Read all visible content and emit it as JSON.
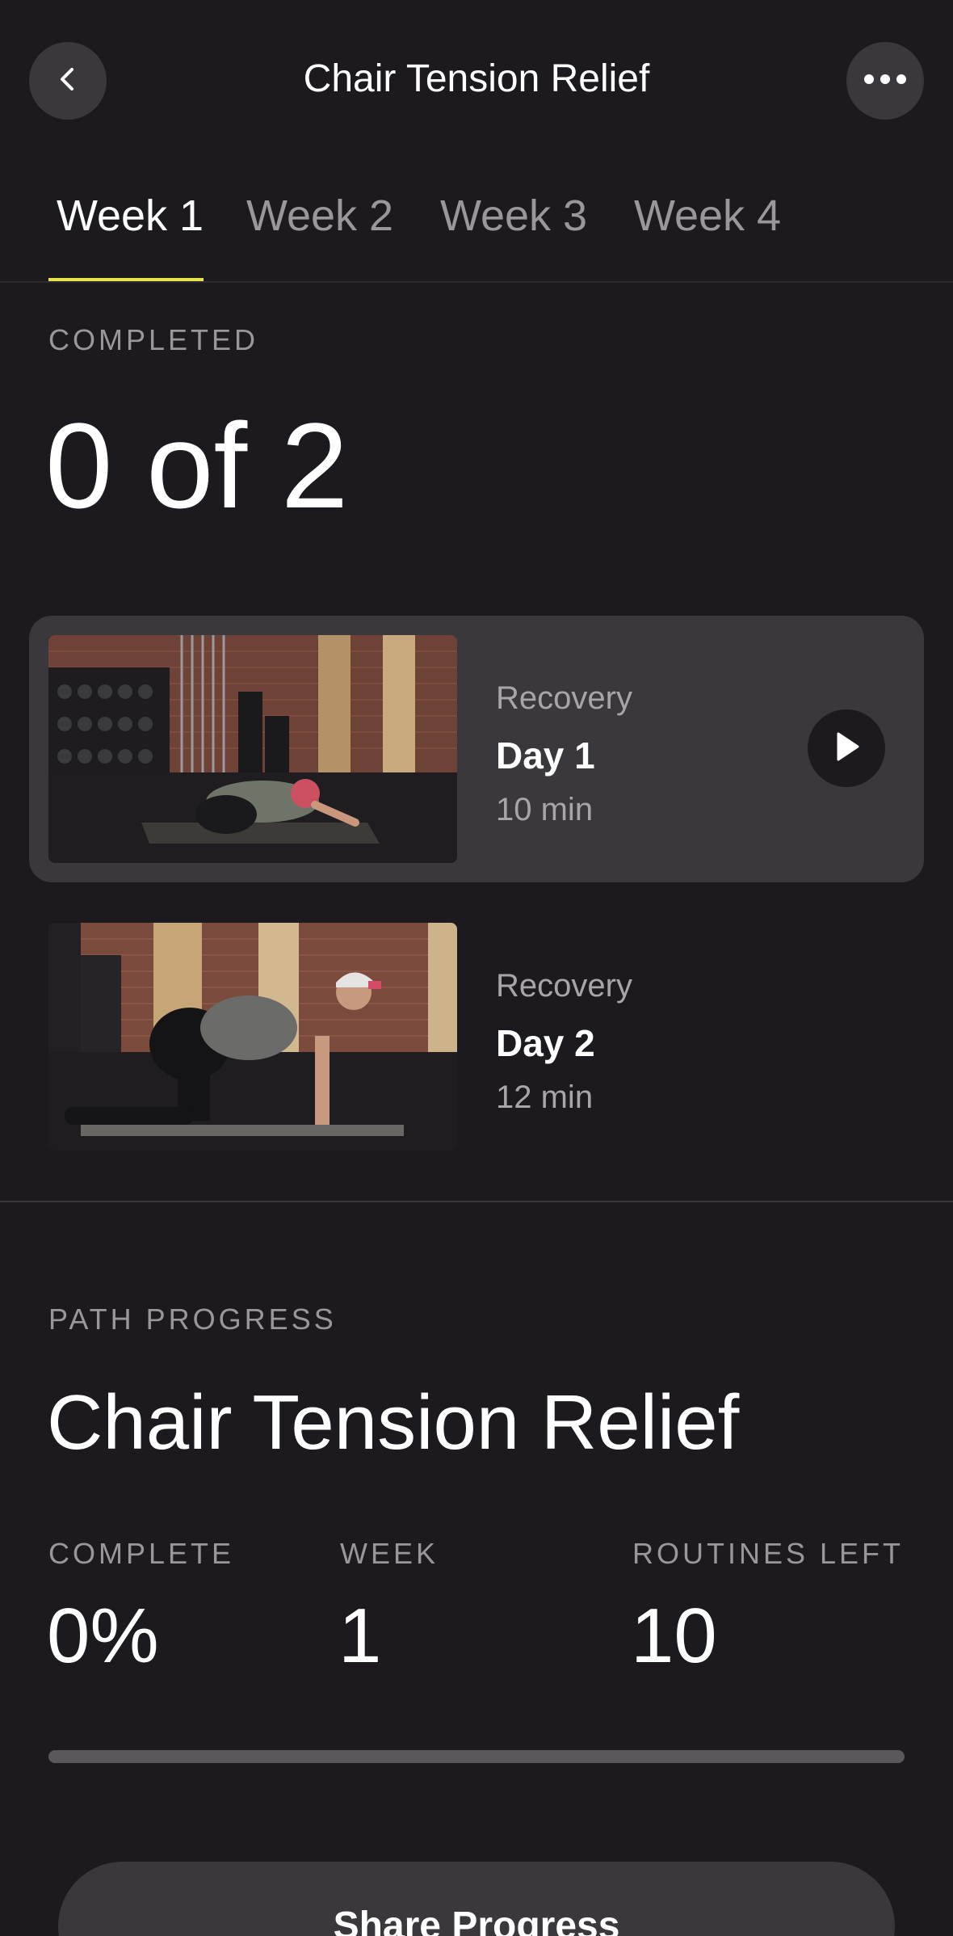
{
  "header": {
    "title": "Chair Tension Relief",
    "back_icon": "chevron-left-icon",
    "more_icon": "more-horizontal-icon"
  },
  "tabs": [
    {
      "label": "Week 1",
      "active": true
    },
    {
      "label": "Week 2",
      "active": false
    },
    {
      "label": "Week 3",
      "active": false
    },
    {
      "label": "Week 4",
      "active": false
    }
  ],
  "completed": {
    "label": "COMPLETED",
    "value": "0 of 2"
  },
  "routines": [
    {
      "category": "Recovery",
      "title": "Day 1",
      "duration": "10 min",
      "active": true
    },
    {
      "category": "Recovery",
      "title": "Day 2",
      "duration": "12 min",
      "active": false
    }
  ],
  "path_progress": {
    "label": "PATH PROGRESS",
    "title": "Chair Tension Relief",
    "stats": [
      {
        "label": "COMPLETE",
        "value": "0%"
      },
      {
        "label": "WEEK",
        "value": "1"
      },
      {
        "label": "ROUTINES LEFT",
        "value": "10"
      }
    ],
    "progress_fraction": 0
  },
  "share_button": {
    "label": "Share Progress"
  },
  "colors": {
    "background": "#1c1a1e",
    "card": "#3a383c",
    "accent": "#e6e24a",
    "muted_text": "#9a979c"
  }
}
